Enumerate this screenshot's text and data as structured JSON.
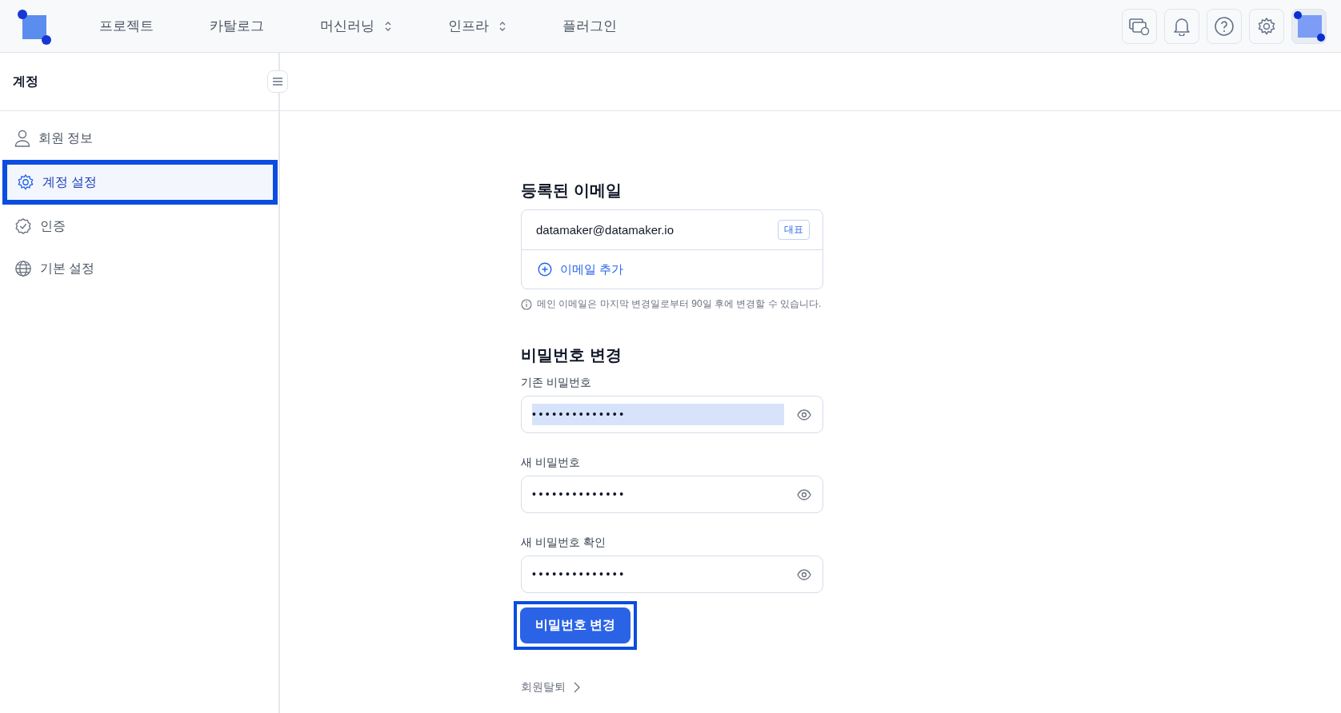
{
  "top_nav": {
    "items": [
      {
        "label": "프로젝트",
        "has_dropdown": false
      },
      {
        "label": "카탈로그",
        "has_dropdown": false
      },
      {
        "label": "머신러닝",
        "has_dropdown": true
      },
      {
        "label": "인프라",
        "has_dropdown": true
      },
      {
        "label": "플러그인",
        "has_dropdown": false
      }
    ]
  },
  "sidebar": {
    "title": "계정",
    "items": [
      {
        "label": "회원 정보",
        "kind": "person",
        "selected": false
      },
      {
        "label": "계정 설정",
        "kind": "gear",
        "selected": true
      },
      {
        "label": "인증",
        "kind": "badge",
        "selected": false
      },
      {
        "label": "기본 설정",
        "kind": "globe",
        "selected": false
      }
    ]
  },
  "email_section": {
    "title": "등록된 이메일",
    "email": "datamaker@datamaker.io",
    "email_tag": "대표",
    "add_email": "이메일 추가",
    "note": "메인 이메일은 마지막 변경일로부터 90일 후에 변경할 수 있습니다."
  },
  "password_section": {
    "title": "비밀번호 변경",
    "fields": [
      {
        "label": "기존 비밀번호",
        "value": "••••••••••••••",
        "text_selected": true
      },
      {
        "label": "새 비밀번호",
        "value": "••••••••••••••",
        "text_selected": false
      },
      {
        "label": "새 비밀번호 확인",
        "value": "••••••••••••••",
        "text_selected": false
      }
    ],
    "submit": {
      "label": "비밀번호 변경",
      "focused": true
    }
  },
  "withdraw_link": "회원탈퇴"
}
